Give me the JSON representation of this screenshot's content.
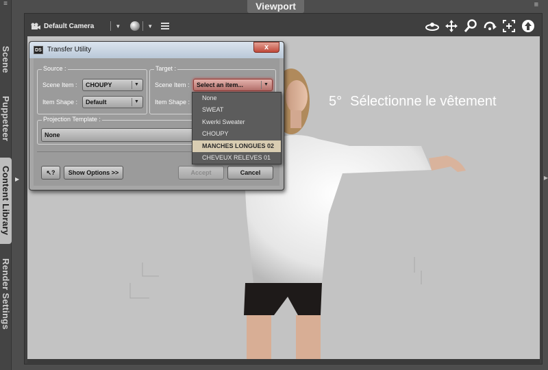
{
  "side_tabs": [
    {
      "label": "Scene"
    },
    {
      "label": "Puppeteer"
    },
    {
      "label": "Content Library"
    },
    {
      "label": "Render Settings"
    }
  ],
  "viewport": {
    "title": "Viewport",
    "camera_label": "Default Camera",
    "nav_icons": [
      "orbit-icon",
      "pan-icon",
      "zoom-icon",
      "roll-icon",
      "frame-icon",
      "up-arrow-icon"
    ]
  },
  "caption": {
    "number": "5°",
    "text": "Sélectionne le vêtement"
  },
  "dialog": {
    "title": "Transfer Utility",
    "close_label": "x",
    "source": {
      "group_label": "Source :",
      "scene_item_label": "Scene Item :",
      "scene_item_value": "CHOUPY",
      "item_shape_label": "Item Shape :",
      "item_shape_value": "Default"
    },
    "target": {
      "group_label": "Target :",
      "scene_item_label": "Scene Item :",
      "scene_item_value": "Select an item...",
      "item_shape_label": "Item Shape :"
    },
    "projection": {
      "group_label": "Projection Template :",
      "value": "None"
    },
    "buttons": {
      "help": "?",
      "show_options": "Show Options >>",
      "accept": "Accept",
      "cancel": "Cancel"
    }
  },
  "dropdown": {
    "items": [
      "None",
      "SWEAT",
      "Kwerki Sweater",
      "CHOUPY",
      "MANCHES LONGUES 02",
      "CHEVEUX RELEVES 01"
    ],
    "selected_index": 4
  },
  "colors": {
    "accent_red": "#c0493a",
    "highlight": "#d9cdb2",
    "viewport_bg": "#c3c3c3"
  }
}
